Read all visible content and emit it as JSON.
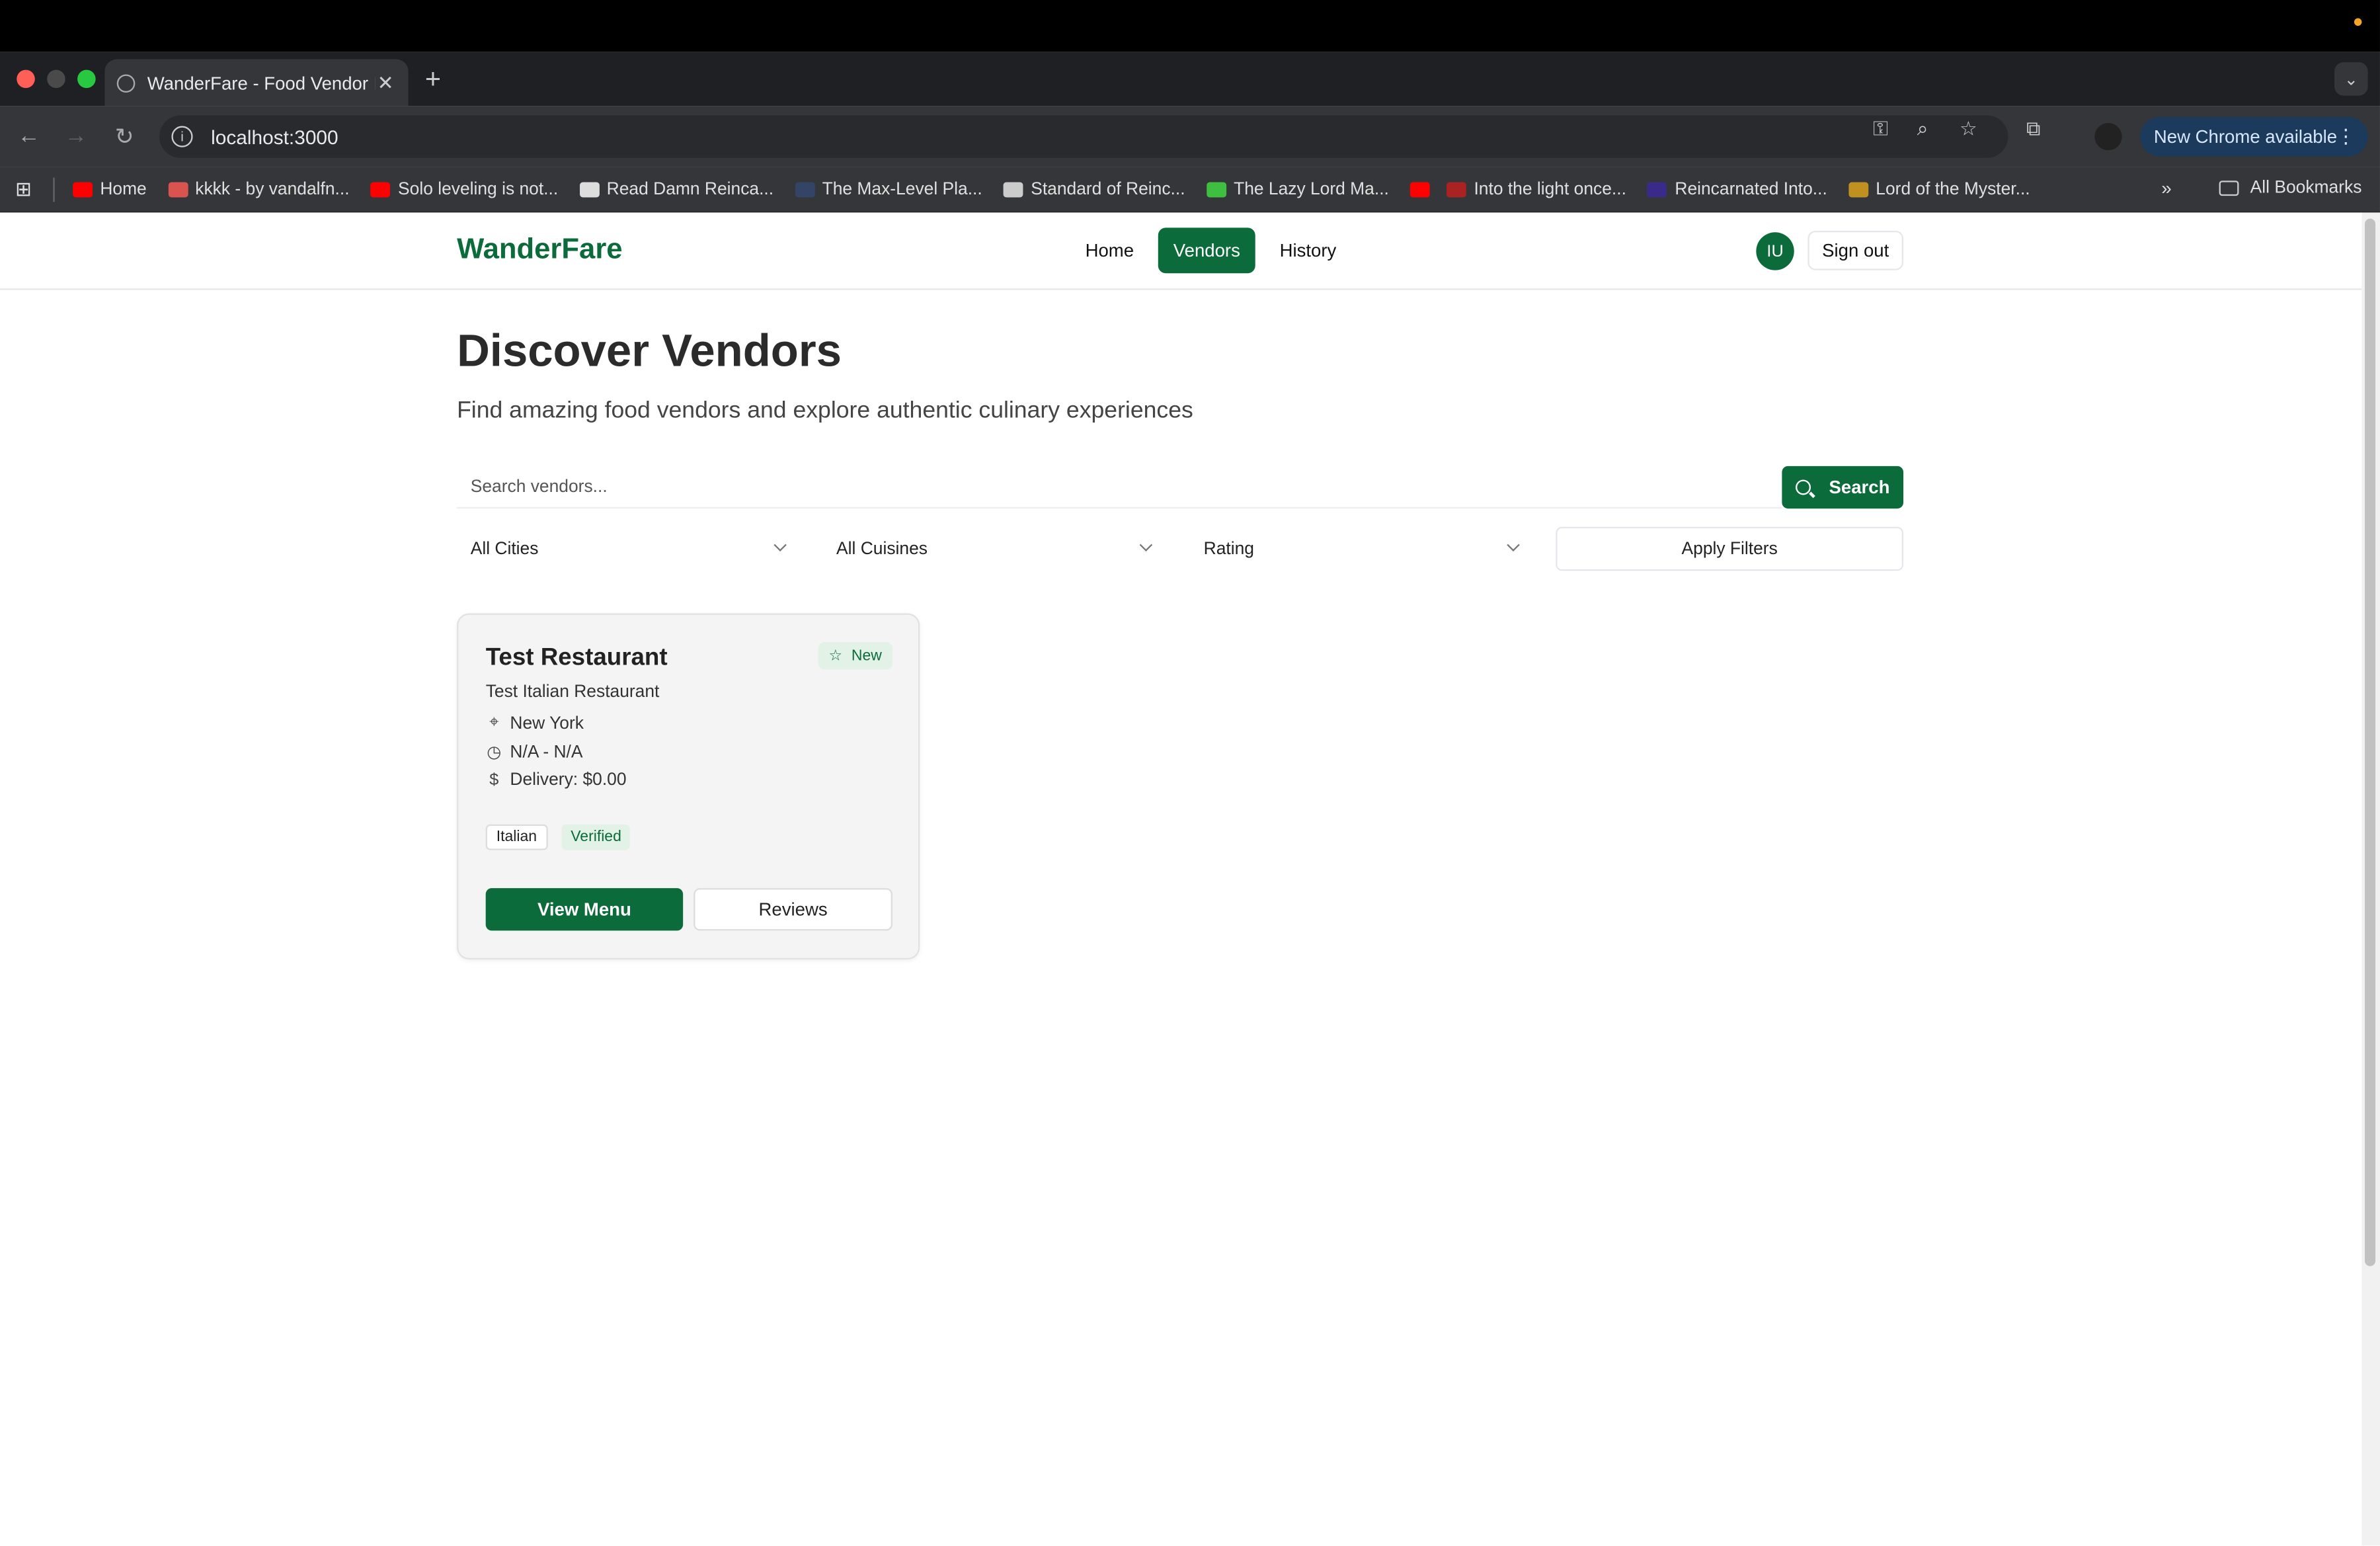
{
  "browser": {
    "tab_title": "WanderFare - Food Vendor M",
    "url": "localhost:3000",
    "new_chrome_label": "New Chrome available",
    "bookmarks": [
      {
        "label": "Home",
        "color": "#ff0000"
      },
      {
        "label": "kkkk - by vandalfn...",
        "color": "#d9534f"
      },
      {
        "label": "Solo leveling is not...",
        "color": "#ff0000"
      },
      {
        "label": "Read Damn Reinca...",
        "color": "#dddddd"
      },
      {
        "label": "The Max-Level Pla...",
        "color": "#334466"
      },
      {
        "label": "Standard of Reinc...",
        "color": "#cccccc"
      },
      {
        "label": "The Lazy Lord Ma...",
        "color": "#3fbf3f"
      },
      {
        "label": "",
        "color": "#ff0000"
      },
      {
        "label": "Into the light once...",
        "color": "#aa2222"
      },
      {
        "label": "Reincarnated Into...",
        "color": "#3a2a8a"
      },
      {
        "label": "Lord of the Myster...",
        "color": "#c09020"
      }
    ],
    "all_bookmarks_label": "All Bookmarks"
  },
  "nav": {
    "logo": "WanderFare",
    "links": [
      "Home",
      "Vendors",
      "History"
    ],
    "avatar_initials": "IU",
    "sign_out": "Sign out"
  },
  "main": {
    "title": "Discover Vendors",
    "subtitle": "Find amazing food vendors and explore authentic culinary experiences",
    "search_placeholder": "Search vendors...",
    "search_button": "Search",
    "filters": {
      "city": "All Cities",
      "cuisine": "All Cuisines",
      "rating": "Rating",
      "apply": "Apply Filters"
    }
  },
  "vendor": {
    "name": "Test Restaurant",
    "badge": "New",
    "description": "Test Italian Restaurant",
    "location": "New York",
    "hours": "N/A - N/A",
    "delivery": "Delivery: $0.00",
    "cuisine_tag": "Italian",
    "verified_tag": "Verified",
    "view_menu": "View Menu",
    "reviews": "Reviews"
  },
  "colors": {
    "brand": "#0b6b3a"
  }
}
